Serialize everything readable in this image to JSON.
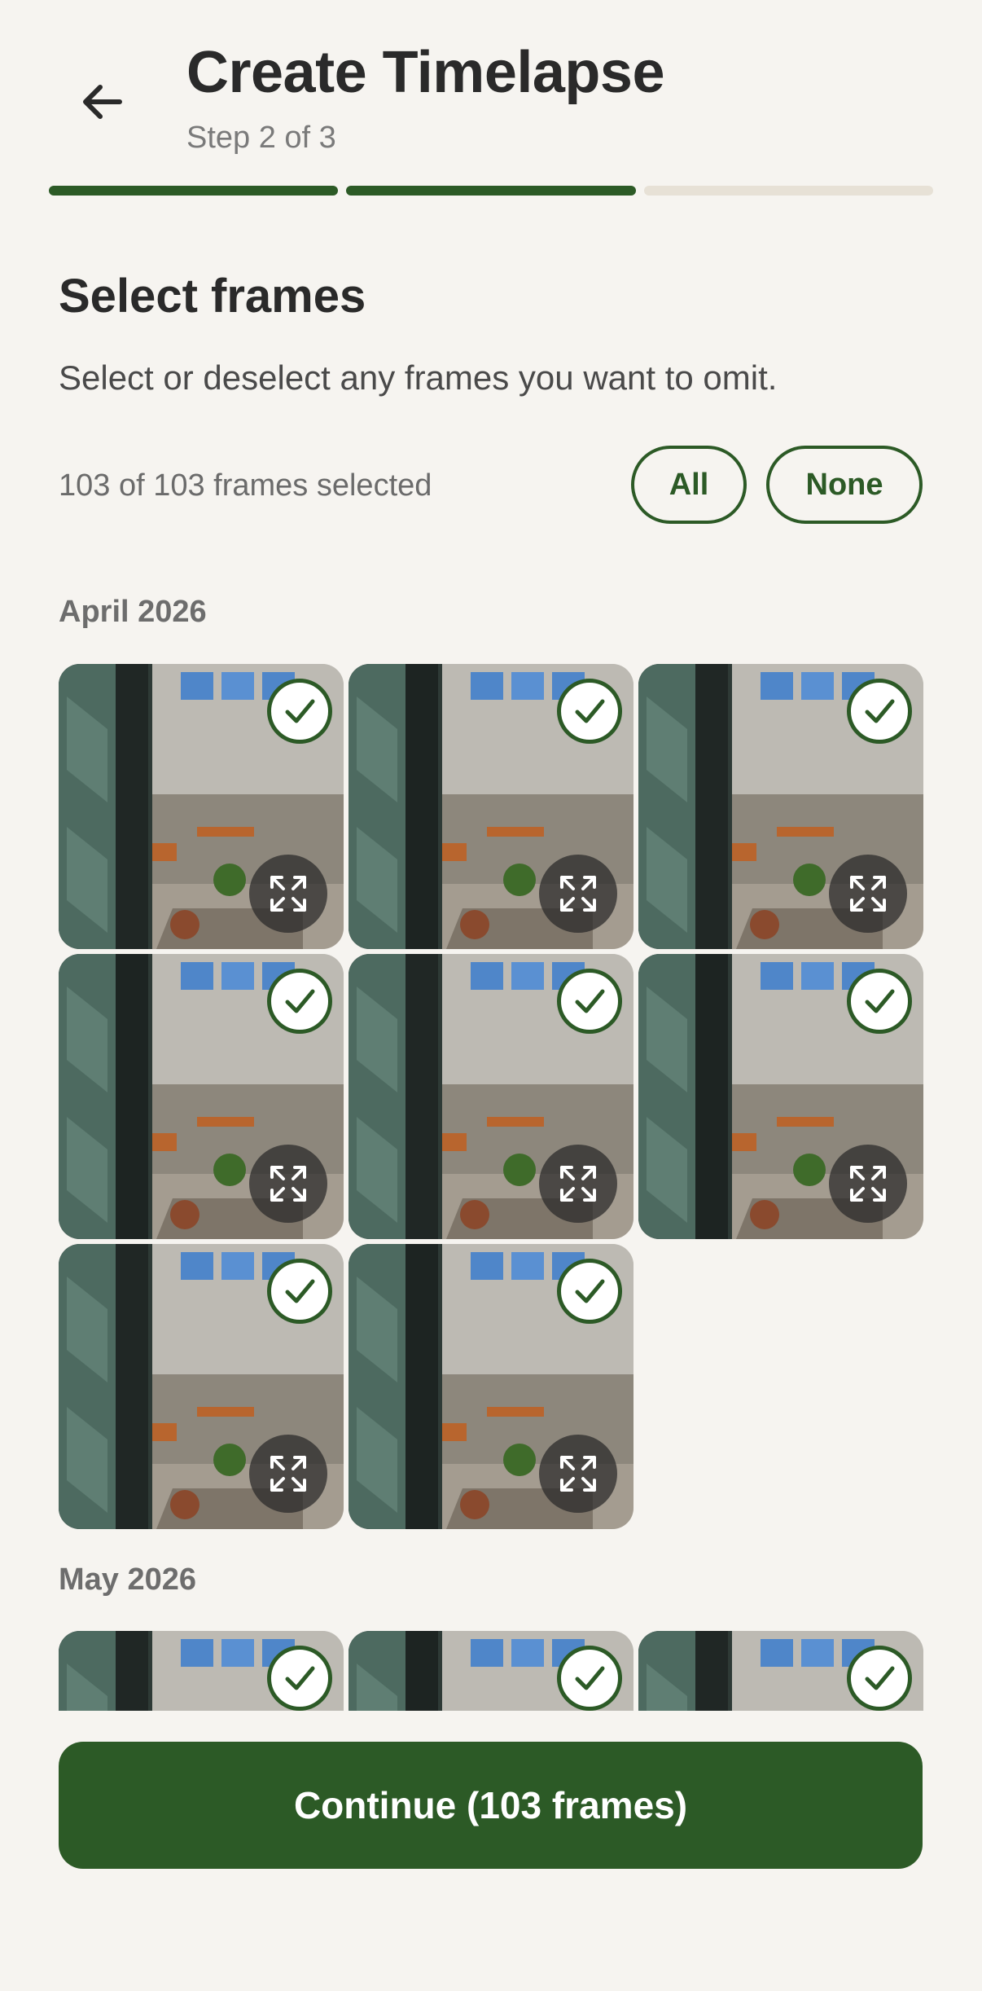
{
  "header": {
    "title": "Create Timelapse",
    "step": "Step 2 of 3",
    "progress": {
      "total_steps": 3,
      "completed_steps": 2
    }
  },
  "section": {
    "title": "Select frames",
    "subtitle": "Select or deselect any frames you want to omit.",
    "count_text": "103 of 103 frames selected",
    "all_label": "All",
    "none_label": "None"
  },
  "groups": [
    {
      "month": "April 2026",
      "frames": [
        {
          "selected": true
        },
        {
          "selected": true
        },
        {
          "selected": true
        },
        {
          "selected": true
        },
        {
          "selected": true
        },
        {
          "selected": true
        },
        {
          "selected": true
        },
        {
          "selected": true
        }
      ]
    },
    {
      "month": "May 2026",
      "frames": [
        {
          "selected": true
        },
        {
          "selected": true
        },
        {
          "selected": true
        }
      ]
    }
  ],
  "icons": {
    "back": "arrow-left-icon",
    "check": "checkmark-icon",
    "expand": "expand-icon"
  },
  "colors": {
    "accent": "#2c5a26",
    "background": "#f6f4f0",
    "track": "#e7e1d6"
  },
  "footer": {
    "continue_label": "Continue (103 frames)"
  }
}
